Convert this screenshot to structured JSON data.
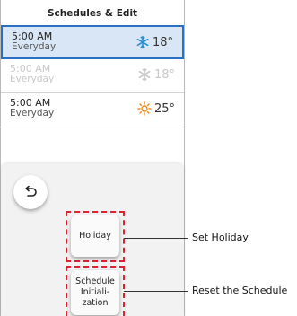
{
  "header": {
    "title": "Schedules & Edit"
  },
  "schedules": [
    {
      "time": "5:00 AM",
      "repeat": "Everyday",
      "mode_icon": "snowflake-icon",
      "temperature": "18°",
      "state": "selected"
    },
    {
      "time": "5:00 AM",
      "repeat": "Everyday",
      "mode_icon": "snowflake-icon",
      "temperature": "18°",
      "state": "disabled"
    },
    {
      "time": "5:00 AM",
      "repeat": "Everyday",
      "mode_icon": "sun-icon",
      "temperature": "25°",
      "state": "normal"
    }
  ],
  "buttons": {
    "holiday": "Holiday",
    "schedule_init_line1": "Schedule",
    "schedule_init_line2": "Initiali-",
    "schedule_init_line3": "zation"
  },
  "callouts": {
    "holiday": "Set Holiday",
    "schedule_init": "Reset the Schedule"
  },
  "colors": {
    "selected_row_bg": "#d9e6f5",
    "selected_border": "#2a6fc2",
    "cool_icon": "#2a8fd6",
    "heat_icon": "#f08a1c",
    "highlight_dash": "#e2202f"
  }
}
